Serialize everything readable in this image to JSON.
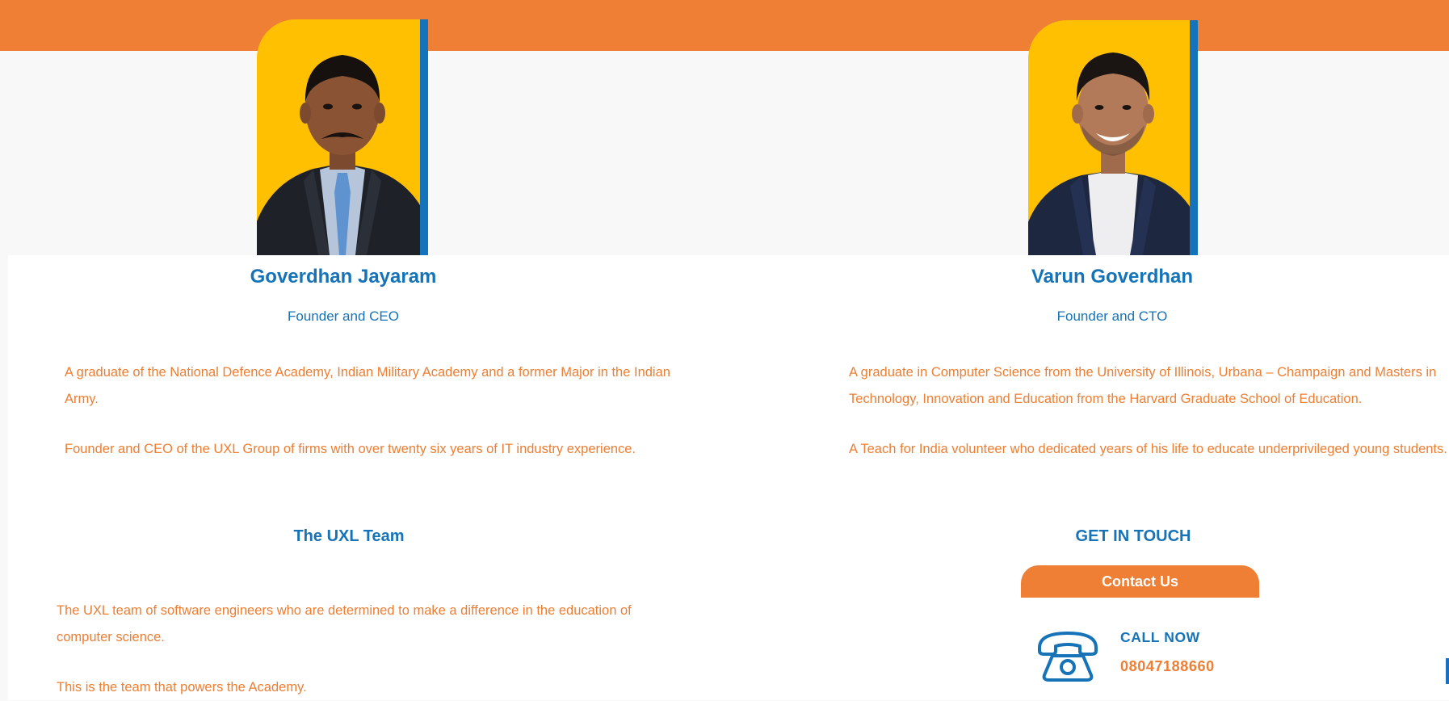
{
  "colors": {
    "orange": "#ee7f34",
    "blue": "#1673b7",
    "yellow": "#ffc001"
  },
  "founders": [
    {
      "name": "Goverdhan Jayaram",
      "role": "Founder and CEO",
      "bio": [
        "A graduate of the National Defence Academy, Indian Military Academy and a former Major in the Indian Army.",
        "Founder and CEO of the UXL Group of firms with over twenty six years of IT industry experience."
      ]
    },
    {
      "name": "Varun Goverdhan",
      "role": "Founder and CTO",
      "bio": [
        "A graduate in Computer Science from the University of Illinois, Urbana – Champaign and Masters in Technology, Innovation and Education from the Harvard Graduate School of Education.",
        "A Teach for India volunteer who dedicated years of his life to educate underprivileged young students."
      ]
    }
  ],
  "team": {
    "title": "The UXL Team",
    "paragraphs": [
      "The UXL team of software engineers who are determined to make a difference in the education of computer science.",
      "This is the team that powers the Academy."
    ]
  },
  "contact": {
    "title": "GET IN TOUCH",
    "button_label": "Contact Us",
    "call_label": "CALL NOW",
    "phone": "08047188660",
    "phone_icon": "telephone-icon"
  }
}
